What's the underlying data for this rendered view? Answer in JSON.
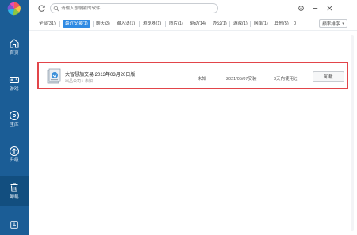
{
  "search": {
    "placeholder": "请输入想搜索的软件"
  },
  "sidebar": {
    "items": [
      {
        "label": "首页"
      },
      {
        "label": "游戏"
      },
      {
        "label": "宝库"
      },
      {
        "label": "升级"
      },
      {
        "label": "卸载"
      }
    ]
  },
  "tabs": [
    {
      "label": "全部(31)"
    },
    {
      "label": "最近安装(1)"
    },
    {
      "label": "聊天(3)"
    },
    {
      "label": "输入法(1)"
    },
    {
      "label": "浏览器(1)"
    },
    {
      "label": "图片(1)"
    },
    {
      "label": "驱动(14)"
    },
    {
      "label": "办公(1)"
    },
    {
      "label": "游戏(1)"
    },
    {
      "label": "网络(1)"
    },
    {
      "label": "其他(5)"
    },
    {
      "label": "0"
    }
  ],
  "sort": {
    "label": "频率排序"
  },
  "apps": [
    {
      "name": "大智慧加交易 2013年03月20日版",
      "publisher": "出品公司：未知",
      "size": "未知",
      "install_date": "2021/05/07安装",
      "frequency": "3天内使用过",
      "action": "卸载"
    }
  ],
  "colors": {
    "sidebar": "#1b5d96",
    "accent": "#2f8ae3",
    "highlight": "#e2454a"
  }
}
